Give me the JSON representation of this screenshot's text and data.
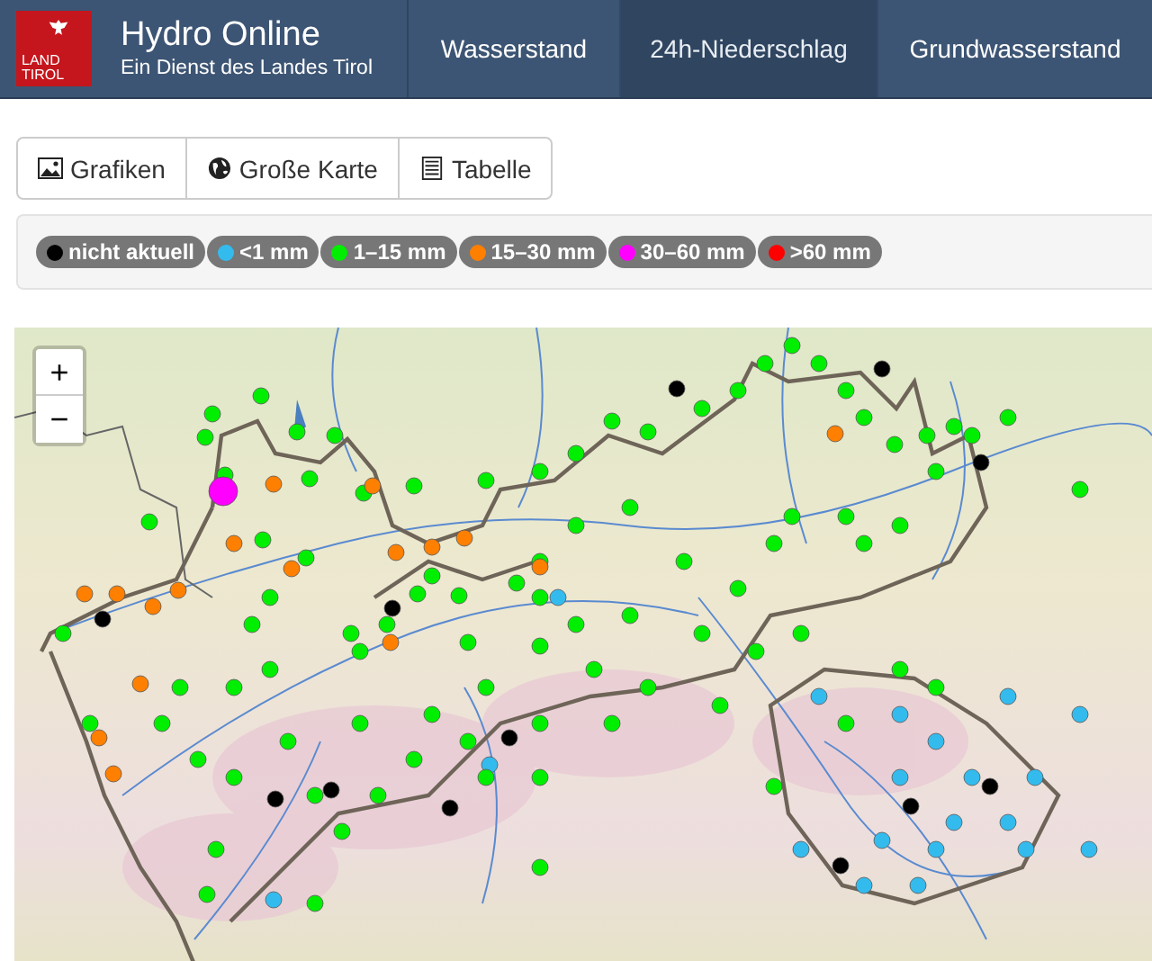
{
  "header": {
    "logo_lines": [
      "LAND",
      "TIROL"
    ],
    "title": "Hydro Online",
    "subtitle": "Ein Dienst des Landes Tirol"
  },
  "nav": [
    {
      "label": "Wasserstand",
      "selected": false
    },
    {
      "label": "24h-Niederschlag",
      "selected": true
    },
    {
      "label": "Grundwasserstand",
      "selected": false
    }
  ],
  "view_buttons": [
    {
      "kind": "image",
      "label": "Grafiken"
    },
    {
      "kind": "globe",
      "label": "Große Karte"
    },
    {
      "kind": "table",
      "label": "Tabelle"
    }
  ],
  "legend": [
    {
      "label": "nicht aktuell",
      "color": "#000000"
    },
    {
      "label": "<1 mm",
      "color": "#33bbee"
    },
    {
      "label": "1–15 mm",
      "color": "#00ee00"
    },
    {
      "label": "15–30 mm",
      "color": "#ff7f00"
    },
    {
      "label": "30–60 mm",
      "color": "#ff00ff"
    },
    {
      "label": ">60 mm",
      "color": "#ff0000"
    }
  ],
  "map": {
    "zoom_in": "+",
    "zoom_out": "−"
  }
}
